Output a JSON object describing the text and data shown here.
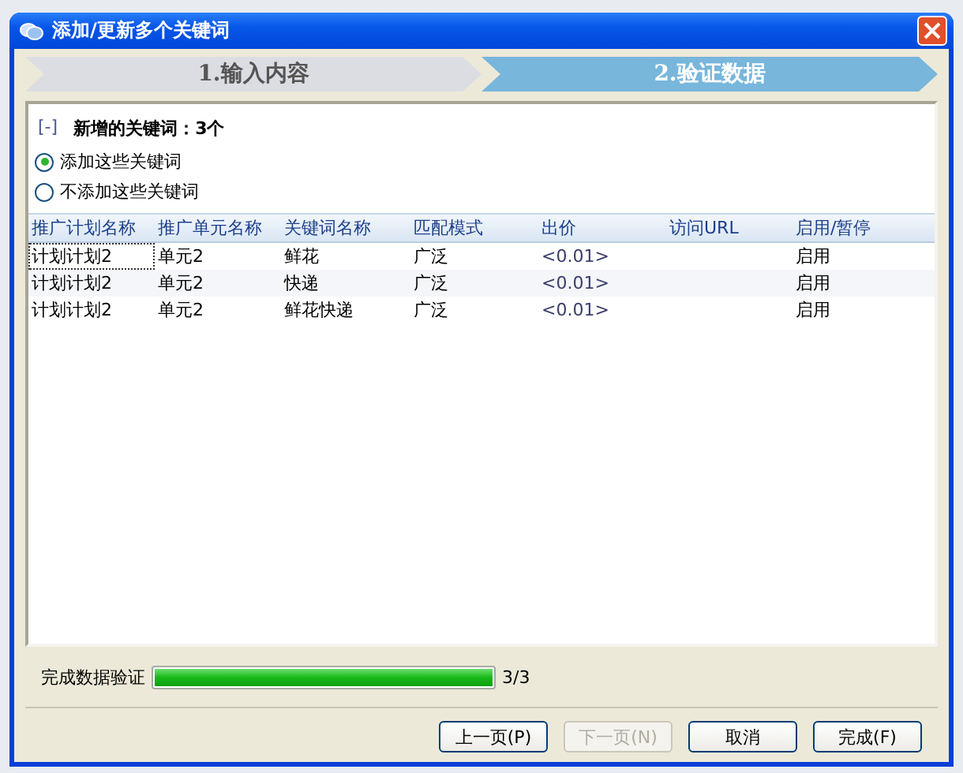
{
  "window": {
    "title": "添加/更新多个关键词"
  },
  "steps": [
    {
      "label": "1.输入内容",
      "selected": false
    },
    {
      "label": "2.验证数据",
      "selected": true
    }
  ],
  "section": {
    "toggle": "[-]",
    "title": "新增的关键词：3个"
  },
  "options": [
    {
      "label": "添加这些关键词",
      "selected": true
    },
    {
      "label": "不添加这些关键词",
      "selected": false
    }
  ],
  "table": {
    "columns": [
      "推广计划名称",
      "推广单元名称",
      "关键词名称",
      "匹配模式",
      "出价",
      "访问URL",
      "启用/暂停"
    ],
    "rows": [
      [
        "计划计划2",
        "单元2",
        "鲜花",
        "广泛",
        "<0.01>",
        "",
        "启用"
      ],
      [
        "计划计划2",
        "单元2",
        "快递",
        "广泛",
        "<0.01>",
        "",
        "启用"
      ],
      [
        "计划计划2",
        "单元2",
        "鲜花快递",
        "广泛",
        "<0.01>",
        "",
        "启用"
      ]
    ]
  },
  "progress": {
    "label": "完成数据验证",
    "level": 1,
    "reading": "3/3"
  },
  "buttons": [
    {
      "label": "上一页(P)",
      "disabled": false
    },
    {
      "label": "下一页(N)",
      "disabled": true
    },
    {
      "label": "取消",
      "disabled": false
    },
    {
      "label": "完成(F)",
      "disabled": false
    }
  ]
}
